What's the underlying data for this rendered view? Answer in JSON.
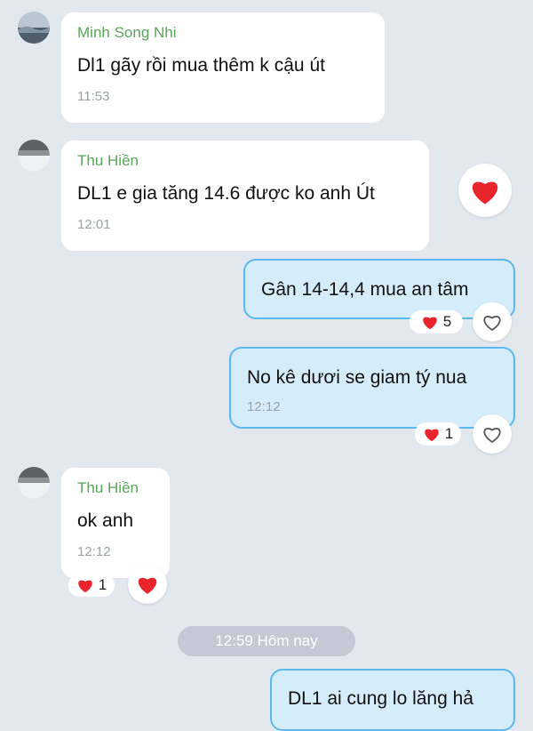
{
  "colors": {
    "background": "#e3e8ef",
    "incoming_bubble": "#ffffff",
    "outgoing_bubble": "#d5ecfb",
    "outgoing_border": "#5db8ef",
    "sender_name": "#5aa65a",
    "timestamp": "#9aa1a8",
    "heart": "#e8242c",
    "date_pill": "#c3cad3"
  },
  "messages": [
    {
      "sender": "Minh Song Nhi",
      "text": "Dl1 gãy rồi mua thêm k cậu út",
      "time": "11:53"
    },
    {
      "sender": "Thu Hiền",
      "text": "DL1 e gia tăng 14.6 được ko anh Út",
      "time": "12:01",
      "reaction_icon": "heart-icon"
    },
    {
      "text": "Gân 14-14,4 mua an tâm",
      "reaction_count": "5",
      "react_icon": "heart-outline-icon"
    },
    {
      "text": "No kê dươi se giam tý nua",
      "time": "12:12",
      "reaction_count": "1",
      "react_icon": "heart-outline-icon"
    },
    {
      "sender": "Thu Hiền",
      "text": "ok anh",
      "time": "12:12",
      "reaction_count": "1",
      "react_icon": "heart-icon"
    },
    {
      "text": "DL1 ai cung lo lăng hả"
    }
  ],
  "date_separator": "12:59 Hôm nay"
}
